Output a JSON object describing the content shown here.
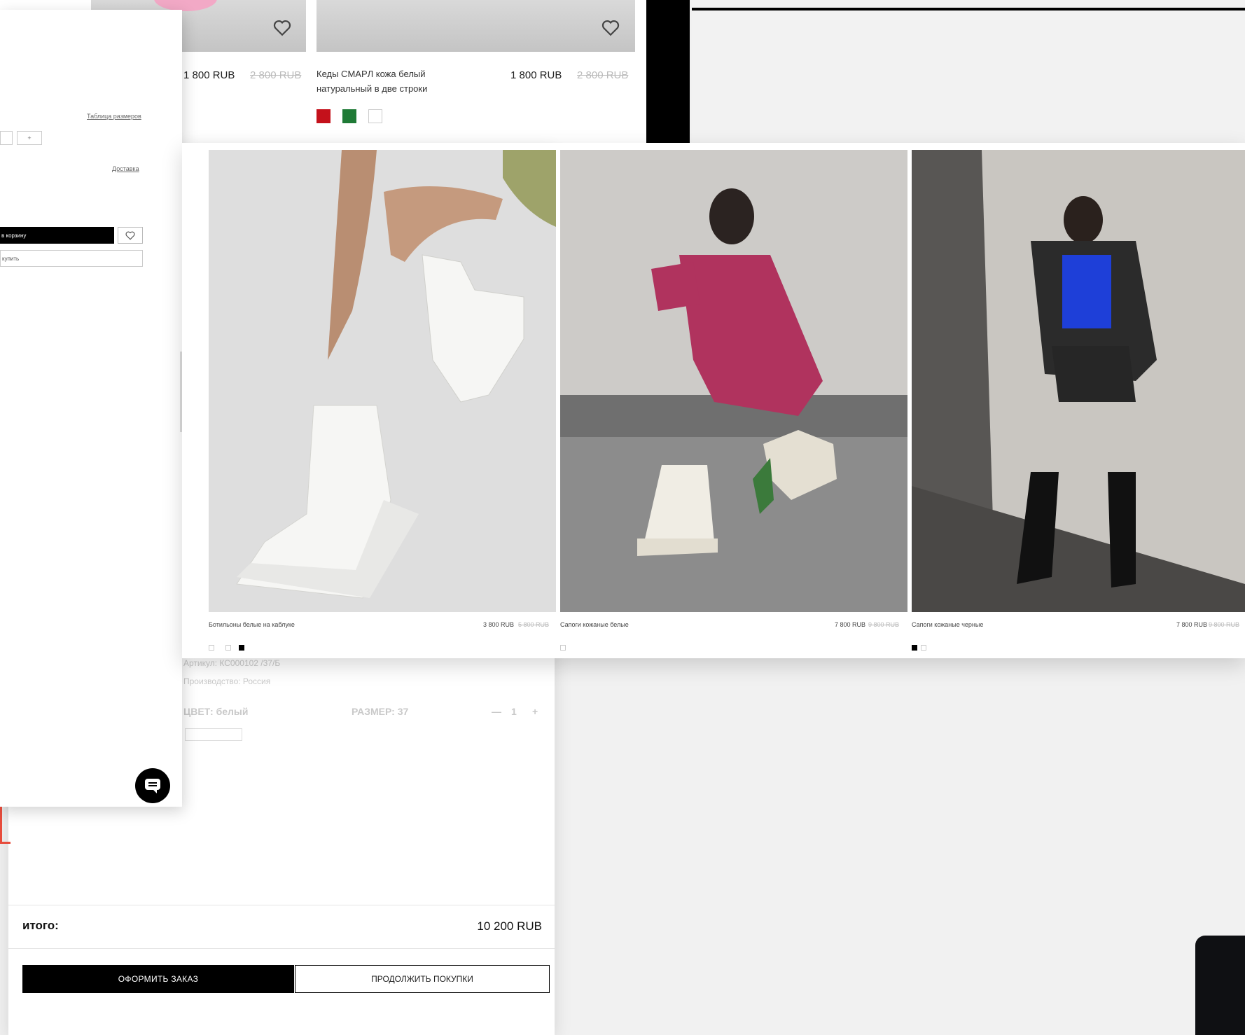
{
  "catalog": {
    "items": [
      {
        "name": "",
        "price": "1 800 RUB",
        "old_price": "2 800 RUB"
      },
      {
        "name": "Кеды CMAPЛ кожа белый натуральный в две строки",
        "price": "1 800 RUB",
        "old_price": "2 800 RUB",
        "swatches": [
          "#c4111b",
          "#1f7a36",
          "#ffffff"
        ]
      }
    ]
  },
  "detail": {
    "size_guide_link": "Таблица размеров",
    "qty_minus": "–",
    "qty_plus": "+",
    "delivery_link": "Доставка",
    "add_to_cart": "в корзину",
    "buy_now": "купить"
  },
  "lookbook": {
    "items": [
      {
        "caption": "Ботильоны белые на каблуке",
        "price": "3 800 RUB",
        "old_price": "5 800 RUB"
      },
      {
        "caption": "Сапоги кожаные белые",
        "price": "7 800 RUB",
        "old_price": "9 800 RUB"
      },
      {
        "caption": "Сапоги кожаные черные",
        "price": "7 800 RUB",
        "old_price": "9 800 RUB"
      }
    ]
  },
  "cart": {
    "item_article": "Артикул: КС000102 /37/Б",
    "item_brand": "Производство: Россия",
    "color_label": "ЦВЕТ: белый",
    "size_label": "РАЗМЕР: 37",
    "qty_minus": "—",
    "qty_value": "1",
    "qty_plus": "+",
    "total_label": "итого:",
    "total_value": "10 200 RUB",
    "checkout": "ОФОРМИТЬ ЗАКАЗ",
    "continue": "ПРОДОЛЖИТЬ ПОКУПКИ"
  },
  "colors": {
    "accent": "#000000",
    "sale_strike": "#bbbbbb",
    "warning": "#e74c3c",
    "page_bg": "#f1f1f1"
  }
}
